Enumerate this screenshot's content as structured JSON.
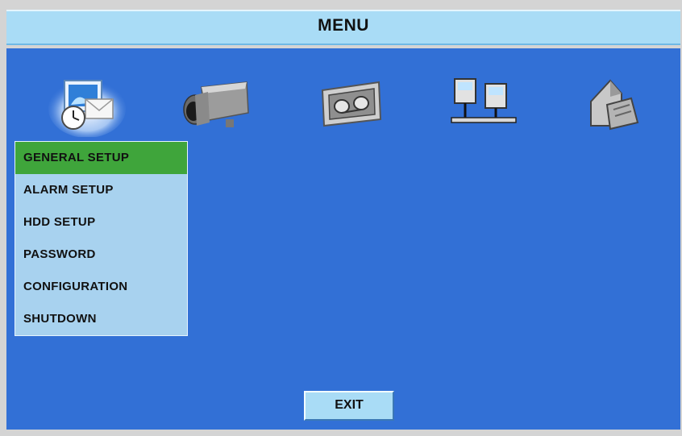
{
  "window": {
    "title": "MENU"
  },
  "top_icons": [
    {
      "name": "system-settings-icon",
      "selected": true
    },
    {
      "name": "camera-icon",
      "selected": false
    },
    {
      "name": "recording-tape-icon",
      "selected": false
    },
    {
      "name": "network-icon",
      "selected": false
    },
    {
      "name": "event-log-icon",
      "selected": false
    }
  ],
  "submenu": {
    "items": [
      {
        "label": "GENERAL SETUP",
        "active": true
      },
      {
        "label": "ALARM SETUP",
        "active": false
      },
      {
        "label": "HDD SETUP",
        "active": false
      },
      {
        "label": "PASSWORD",
        "active": false
      },
      {
        "label": "CONFIGURATION",
        "active": false
      },
      {
        "label": "SHUTDOWN",
        "active": false
      }
    ]
  },
  "footer": {
    "exit_label": "EXIT"
  },
  "colors": {
    "panel_bg": "#3270d6",
    "title_bar": "#a9dcf6",
    "submenu_bg": "#a8d2ef",
    "active_item": "#3fa53b"
  }
}
